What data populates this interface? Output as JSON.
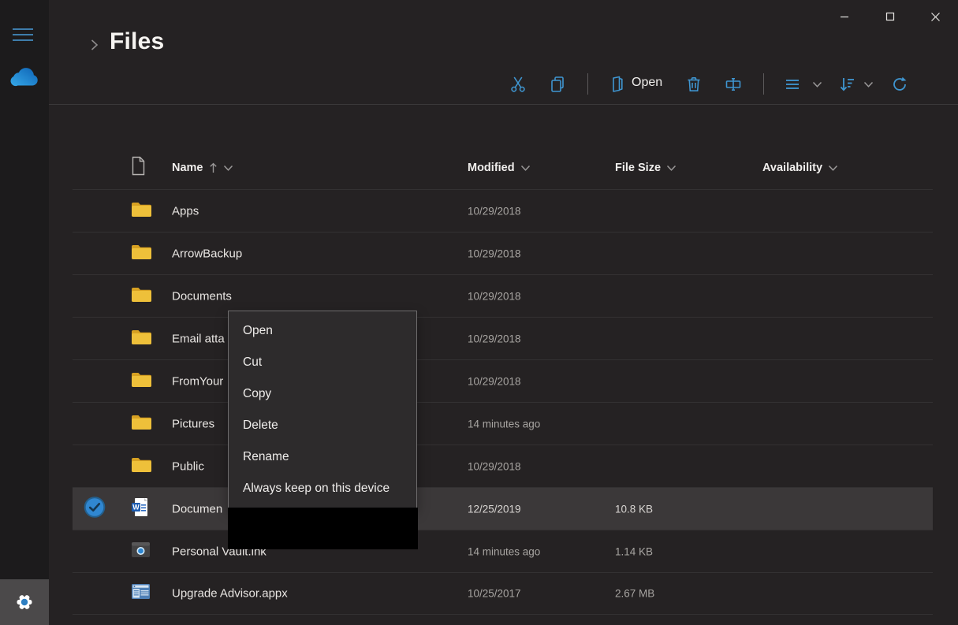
{
  "titlebar": {
    "controls": {
      "minimize": "minimize",
      "maximize": "maximize",
      "close": "close"
    }
  },
  "sidebar": {
    "icons": [
      "menu",
      "onedrive-cloud",
      "settings-gear"
    ]
  },
  "breadcrumb": {
    "title": "Files"
  },
  "toolbar": {
    "open_label": "Open",
    "icons": [
      "cut",
      "copy",
      "open",
      "delete",
      "rename",
      "view-options",
      "sort",
      "refresh"
    ]
  },
  "table": {
    "columns": {
      "name": {
        "label": "Name",
        "sort": "ascending"
      },
      "modified": {
        "label": "Modified"
      },
      "file_size": {
        "label": "File Size"
      },
      "availability": {
        "label": "Availability"
      }
    },
    "rows": [
      {
        "name": "Apps",
        "icon": "folder",
        "modified": "10/29/2018",
        "file_size": "",
        "availability": "",
        "selected": false
      },
      {
        "name": "ArrowBackup",
        "icon": "folder",
        "modified": "10/29/2018",
        "file_size": "",
        "availability": "",
        "selected": false
      },
      {
        "name": "Documents",
        "icon": "folder",
        "modified": "10/29/2018",
        "file_size": "",
        "availability": "",
        "selected": false
      },
      {
        "name": "Email atta",
        "icon": "folder",
        "modified": "10/29/2018",
        "file_size": "",
        "availability": "",
        "selected": false
      },
      {
        "name": "FromYour",
        "icon": "folder",
        "modified": "10/29/2018",
        "file_size": "",
        "availability": "",
        "selected": false
      },
      {
        "name": "Pictures",
        "icon": "folder",
        "modified": "14 minutes ago",
        "file_size": "",
        "availability": "",
        "selected": false
      },
      {
        "name": "Public",
        "icon": "folder",
        "modified": "10/29/2018",
        "file_size": "",
        "availability": "",
        "selected": false
      },
      {
        "name": "Documen",
        "icon": "word-document",
        "modified": "12/25/2019",
        "file_size": "10.8 KB",
        "availability": "",
        "selected": true
      },
      {
        "name": "Personal Vault.lnk",
        "icon": "shortcut",
        "modified": "14 minutes ago",
        "file_size": "1.14 KB",
        "availability": "",
        "selected": false
      },
      {
        "name": "Upgrade Advisor.appx",
        "icon": "app-package",
        "modified": "10/25/2017",
        "file_size": "2.67 MB",
        "availability": "",
        "selected": false
      }
    ]
  },
  "context_menu": {
    "items": [
      "Open",
      "Cut",
      "Copy",
      "Delete",
      "Rename",
      "Always keep on this device"
    ],
    "redacted_area": true
  },
  "colors": {
    "accent_blue": "#3f96d1",
    "selected_row": "#3b3839",
    "folder_yellow": "#eec03a",
    "background": "#252223",
    "sidebar": "#1c1b1c",
    "menu_background": "#2d2b2c"
  }
}
